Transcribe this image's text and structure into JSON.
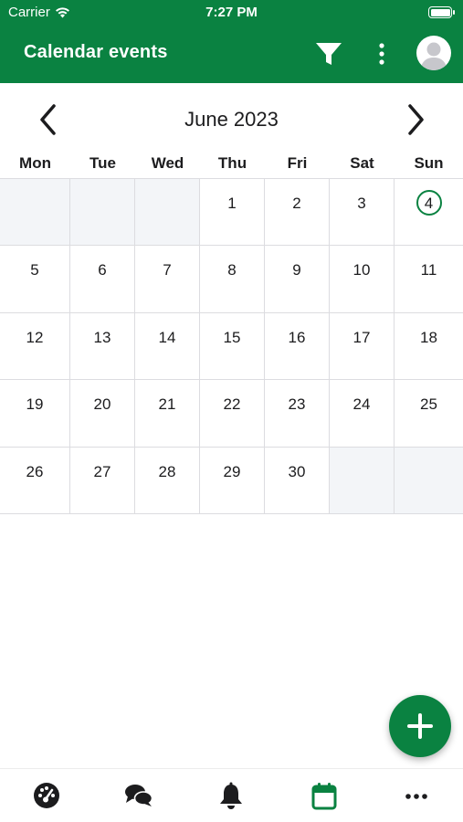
{
  "status_bar": {
    "carrier": "Carrier",
    "time": "7:27 PM",
    "battery_level": 1.0
  },
  "app_bar": {
    "title": "Calendar events",
    "icons": [
      "filter-icon",
      "more-vertical-icon",
      "user-avatar-icon"
    ]
  },
  "calendar": {
    "month_title": "June 2023",
    "weekdays": [
      "Mon",
      "Tue",
      "Wed",
      "Thu",
      "Fri",
      "Sat",
      "Sun"
    ],
    "leading_empty_days": 3,
    "days_in_month": 30,
    "today": 4,
    "colors": {
      "accent": "#0a8241",
      "empty_cell": "#f3f5f8",
      "grid_line": "#dcdce0"
    }
  },
  "fab": {
    "icon": "plus-icon"
  },
  "tab_bar": {
    "tabs": [
      {
        "icon": "dashboard-icon",
        "active": false
      },
      {
        "icon": "chat-icon",
        "active": false
      },
      {
        "icon": "bell-icon",
        "active": false
      },
      {
        "icon": "calendar-icon",
        "active": true
      },
      {
        "icon": "more-horizontal-icon",
        "active": false
      }
    ],
    "active_color": "#0a8241",
    "inactive_color": "#1c1c1e"
  }
}
